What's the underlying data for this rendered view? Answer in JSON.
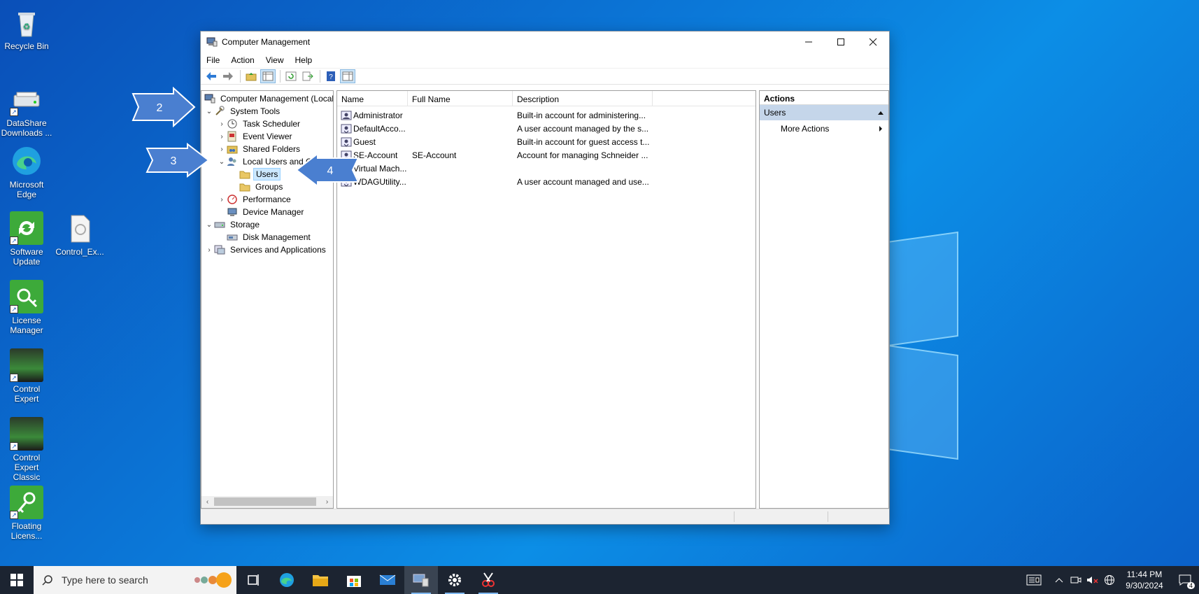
{
  "desktop": {
    "icons": [
      {
        "label": "Recycle Bin",
        "icon": "recycle-bin-icon"
      },
      {
        "label": "DataShare Downloads ...",
        "icon": "drive-icon"
      },
      {
        "label": "Microsoft Edge",
        "icon": "edge-icon"
      },
      {
        "label": "Software Update",
        "icon": "software-update-icon"
      },
      {
        "label": "Control_Ex...",
        "icon": "file-icon"
      },
      {
        "label": "License Manager",
        "icon": "license-manager-icon"
      },
      {
        "label": "Control Expert",
        "icon": "control-expert-icon"
      },
      {
        "label": "Control Expert Classic",
        "icon": "control-expert-classic-icon"
      },
      {
        "label": "Floating Licens...",
        "icon": "floating-license-icon"
      }
    ]
  },
  "window": {
    "title": "Computer Management",
    "menu": [
      "File",
      "Action",
      "View",
      "Help"
    ],
    "tree": [
      {
        "label": "Computer Management (Local",
        "icon": "computer-management-icon",
        "chevron": ""
      },
      {
        "label": "System Tools",
        "icon": "system-tools-icon",
        "chevron": "expanded"
      },
      {
        "label": "Task Scheduler",
        "icon": "task-scheduler-icon",
        "chevron": "collapsed"
      },
      {
        "label": "Event Viewer",
        "icon": "event-viewer-icon",
        "chevron": "collapsed"
      },
      {
        "label": "Shared Folders",
        "icon": "shared-folders-icon",
        "chevron": "collapsed"
      },
      {
        "label": "Local Users and Groups",
        "icon": "local-users-icon",
        "chevron": "expanded"
      },
      {
        "label": "Users",
        "icon": "folder-icon",
        "chevron": "",
        "selected": true
      },
      {
        "label": "Groups",
        "icon": "folder-icon",
        "chevron": ""
      },
      {
        "label": "Performance",
        "icon": "performance-icon",
        "chevron": "collapsed"
      },
      {
        "label": "Device Manager",
        "icon": "device-manager-icon",
        "chevron": ""
      },
      {
        "label": "Storage",
        "icon": "storage-icon",
        "chevron": "expanded"
      },
      {
        "label": "Disk Management",
        "icon": "disk-management-icon",
        "chevron": ""
      },
      {
        "label": "Services and Applications",
        "icon": "services-icon",
        "chevron": "collapsed"
      }
    ],
    "list": {
      "columns": [
        "Name",
        "Full Name",
        "Description"
      ],
      "rows": [
        {
          "name": "Administrator",
          "full_name": "",
          "description": "Built-in account for administering..."
        },
        {
          "name": "DefaultAcco...",
          "full_name": "",
          "description": "A user account managed by the s..."
        },
        {
          "name": "Guest",
          "full_name": "",
          "description": "Built-in account for guest access t..."
        },
        {
          "name": "SE-Account",
          "full_name": "SE-Account",
          "description": "Account for managing Schneider ..."
        },
        {
          "name": "Virtual Mach...",
          "full_name": "",
          "description": ""
        },
        {
          "name": "WDAGUtility...",
          "full_name": "",
          "description": "A user account managed and use..."
        }
      ]
    },
    "actions": {
      "header": "Actions",
      "section": "Users",
      "items": [
        "More Actions"
      ]
    }
  },
  "callouts": [
    "2",
    "3",
    "4"
  ],
  "taskbar": {
    "search_placeholder": "Type here to search",
    "time": "11:44 PM",
    "date": "9/30/2024",
    "notification_count": "4"
  }
}
